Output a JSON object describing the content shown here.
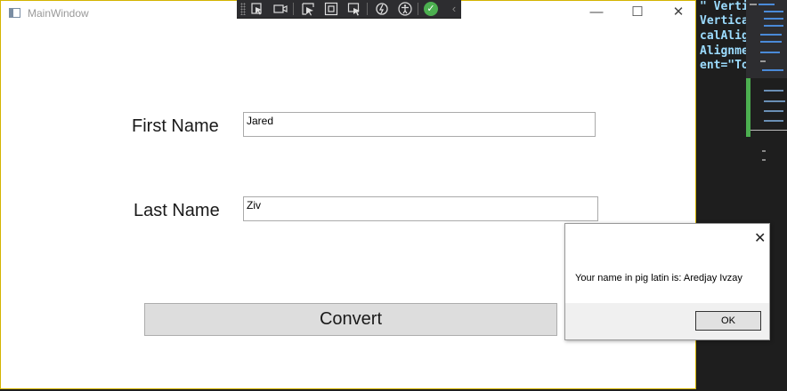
{
  "window": {
    "title": "MainWindow",
    "minimize_glyph": "—",
    "maximize_glyph": "☐",
    "close_glyph": "✕"
  },
  "form": {
    "first_name_label": "First Name",
    "first_name_value": "Jared",
    "last_name_label": "Last Name",
    "last_name_value": "Ziv",
    "convert_label": "Convert"
  },
  "message_box": {
    "close_glyph": "✕",
    "message": "Your name in pig latin is: Aredjay Ivzay",
    "ok_label": "OK"
  },
  "editor": {
    "lines": [
      "\" Verti",
      "Vertica",
      "calAlig",
      "Alignme",
      "ent=\"To"
    ]
  },
  "debug_toolbar": {
    "tools": [
      "select-element-icon",
      "record-icon",
      "select-in-app-icon",
      "display-adorners-icon",
      "track-focus-icon",
      "hot-reload-icon",
      "accessibility-icon",
      "binding-check-icon",
      "collapse-chevron-icon"
    ]
  }
}
